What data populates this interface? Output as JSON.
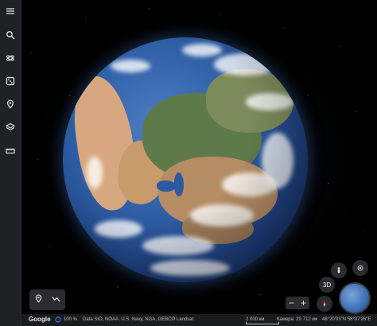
{
  "sidebar": {
    "items": [
      {
        "name": "menu-icon"
      },
      {
        "name": "search-icon"
      },
      {
        "name": "voyager-icon"
      },
      {
        "name": "feeling-lucky-icon"
      },
      {
        "name": "projects-icon"
      },
      {
        "name": "map-style-icon"
      },
      {
        "name": "measure-icon"
      }
    ]
  },
  "controls": {
    "view_mode_label": "3D",
    "zoom_out_label": "−",
    "zoom_in_label": "+"
  },
  "status": {
    "logo": "Google",
    "load_progress": "100 %",
    "attribution": "Data SIO, NOAA, U.S. Navy, NGA, GEBCO  Landsat",
    "scale": "2 000 км",
    "camera": "Камера: 20 712 км",
    "coordinates": "48°20'03\"N 58°37'26\"E"
  },
  "colors": {
    "sidebar_bg": "#202124",
    "panel_bg": "#2b2c30",
    "ocean": "#2f5fa6",
    "progress_ring": "#4285f4"
  }
}
